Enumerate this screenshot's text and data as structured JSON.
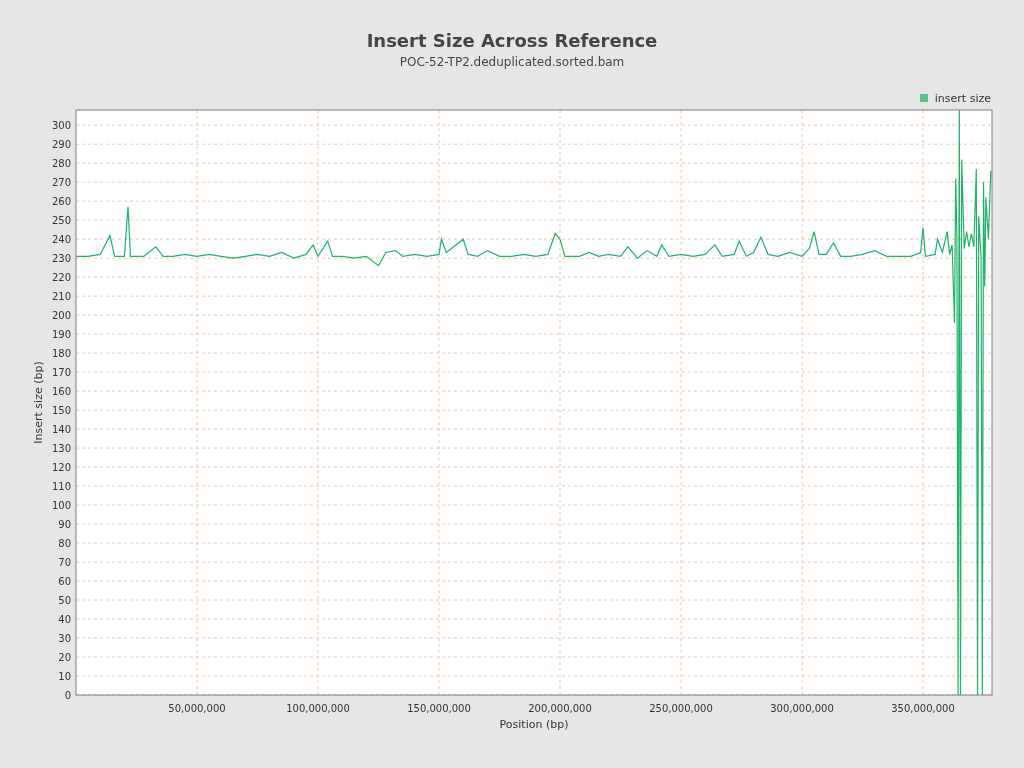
{
  "chart": {
    "subtitle": "POC-52-TP2.deduplicated.sorted.bam",
    "chart_data": {
      "type": "line",
      "title": "Insert Size Across Reference",
      "xlabel": "Position (bp)",
      "ylabel": "Insert size (bp)",
      "grid": true,
      "xlim": [
        0,
        378500000
      ],
      "ylim": [
        0,
        308
      ],
      "xticks": [
        {
          "value": 50000000,
          "label": "50,000,000"
        },
        {
          "value": 100000000,
          "label": "100,000,000"
        },
        {
          "value": 150000000,
          "label": "150,000,000"
        },
        {
          "value": 200000000,
          "label": "200,000,000"
        },
        {
          "value": 250000000,
          "label": "250,000,000"
        },
        {
          "value": 300000000,
          "label": "300,000,000"
        },
        {
          "value": 350000000,
          "label": "350,000,000"
        }
      ],
      "yticks": [
        0,
        10,
        20,
        30,
        40,
        50,
        60,
        70,
        80,
        90,
        100,
        110,
        120,
        130,
        140,
        150,
        160,
        170,
        180,
        190,
        200,
        210,
        220,
        230,
        240,
        250,
        260,
        270,
        280,
        290,
        300
      ],
      "x": [
        0,
        5000000,
        10000000,
        14000000,
        16000000,
        20000000,
        21500000,
        22500000,
        28000000,
        33000000,
        36000000,
        40000000,
        45000000,
        50000000,
        55000000,
        60000000,
        65000000,
        70000000,
        75000000,
        80000000,
        85000000,
        90000000,
        95000000,
        98000000,
        100000000,
        104000000,
        106000000,
        110000000,
        115000000,
        120000000,
        125000000,
        128000000,
        132000000,
        135000000,
        140000000,
        145000000,
        150000000,
        151000000,
        153000000,
        158000000,
        160000000,
        162000000,
        166000000,
        170000000,
        175000000,
        180000000,
        185000000,
        190000000,
        195000000,
        198000000,
        200000000,
        202000000,
        208000000,
        212000000,
        216000000,
        220000000,
        225000000,
        228000000,
        232000000,
        236000000,
        240000000,
        242000000,
        245000000,
        250000000,
        255000000,
        260000000,
        264000000,
        267000000,
        272000000,
        274000000,
        277000000,
        280000000,
        283000000,
        286000000,
        290000000,
        295000000,
        300000000,
        303000000,
        305000000,
        307000000,
        310000000,
        313000000,
        316000000,
        320000000,
        325000000,
        330000000,
        335000000,
        340000000,
        345000000,
        349000000,
        350000000,
        351000000,
        355000000,
        356000000,
        358000000,
        360000000,
        361000000,
        362000000,
        363000000,
        363500000,
        364000000,
        364500000,
        365000000,
        365500000,
        366000000,
        367000000,
        368000000,
        369000000,
        370000000,
        371000000,
        372000000,
        372500000,
        373000000,
        374000000,
        374500000,
        375000000,
        375500000,
        376000000,
        377000000,
        378000000
      ],
      "series": [
        {
          "name": "insert size",
          "color": "#1fb36a",
          "values": [
            231,
            231,
            232,
            242,
            231,
            231,
            257,
            231,
            231,
            236,
            231,
            231,
            232,
            231,
            232,
            231,
            230,
            231,
            232,
            231,
            233,
            230,
            232,
            237,
            231,
            239,
            231,
            231,
            230,
            231,
            226,
            233,
            234,
            231,
            232,
            231,
            232,
            240,
            233,
            238,
            240,
            232,
            231,
            234,
            231,
            231,
            232,
            231,
            232,
            243,
            240,
            231,
            231,
            233,
            231,
            232,
            231,
            236,
            230,
            234,
            231,
            237,
            231,
            232,
            231,
            232,
            237,
            231,
            232,
            239,
            231,
            233,
            241,
            232,
            231,
            233,
            231,
            235,
            244,
            232,
            232,
            238,
            231,
            231,
            232,
            234,
            231,
            231,
            231,
            233,
            246,
            231,
            232,
            240,
            233,
            244,
            232,
            237,
            196,
            272,
            242,
            0,
            308,
            0,
            282,
            235,
            244,
            236,
            243,
            236,
            277,
            0,
            252,
            230,
            0,
            270,
            215,
            262,
            240,
            276
          ]
        }
      ]
    }
  }
}
